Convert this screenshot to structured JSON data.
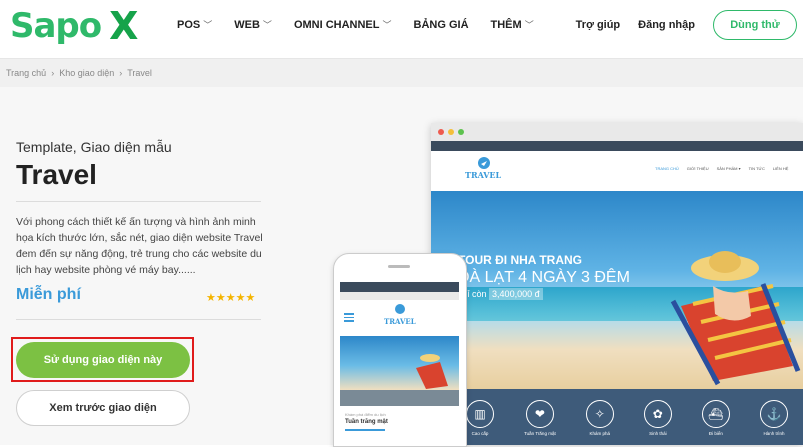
{
  "header": {
    "logo_text_1": "Sapo",
    "logo_text_2": "X",
    "nav": [
      {
        "label": "POS",
        "has_dropdown": true
      },
      {
        "label": "WEB",
        "has_dropdown": true
      },
      {
        "label": "OMNI CHANNEL",
        "has_dropdown": true
      },
      {
        "label": "BẢNG GIÁ",
        "has_dropdown": false
      },
      {
        "label": "THÊM",
        "has_dropdown": true
      }
    ],
    "help_label": "Trợ giúp",
    "login_label": "Đăng nhập",
    "try_label": "Dùng thử"
  },
  "breadcrumb": {
    "items": [
      "Trang chủ",
      "Kho giao diện",
      "Travel"
    ],
    "separator": "›"
  },
  "template": {
    "subtitle": "Template, Giao diện mẫu",
    "title": "Travel",
    "description": "Với phong cách thiết kế ấn tượng và hình ảnh minh họa kích thước lớn, sắc nét, giao diện website Travel đem đến sự năng động, trẻ trung cho các website du lịch hay website phòng vé máy bay......",
    "price": "Miễn phí",
    "rating_stars": 5,
    "stars_text": "★★★★★",
    "use_button": "Sử dụng giao diện này",
    "preview_button": "Xem trước giao diện"
  },
  "mockup": {
    "logo_text": "TRAVEL",
    "menu": [
      "TRANG CHỦ",
      "GIỚI THIỆU",
      "SẢN PHẨM ▾",
      "TIN TỨC",
      "LIÊN HỆ"
    ],
    "hero_line1": "TOUR ĐI NHA TRANG",
    "hero_line2": "ĐÀ LẠT 4 NGÀY 3 ĐÊM",
    "hero_price_prefix": "chỉ còn",
    "hero_price": "3,400,000 đ",
    "icons": [
      {
        "label": "Cao cấp",
        "icon": "building-icon",
        "glyph": "▥"
      },
      {
        "label": "Tuần Trăng mật",
        "icon": "hearts-icon",
        "glyph": "❤"
      },
      {
        "label": "Khám phá",
        "icon": "compass-icon",
        "glyph": "✧"
      },
      {
        "label": "Sinh thái",
        "icon": "palm-icon",
        "glyph": "✿"
      },
      {
        "label": "Đi biển",
        "icon": "ship-icon",
        "glyph": "⛴"
      },
      {
        "label": "Hành trình",
        "icon": "cruise-icon",
        "glyph": "⚓"
      }
    ],
    "phone_section_label": "Khám phá điểm du lịch",
    "phone_section_title": "Tuần trăng mật"
  },
  "colors": {
    "brand_green": "#2fb96a",
    "use_button_bg": "#7cc143",
    "price_blue": "#3a9ad9",
    "highlight_red": "#e01b1b",
    "star_gold": "#f4b400"
  }
}
